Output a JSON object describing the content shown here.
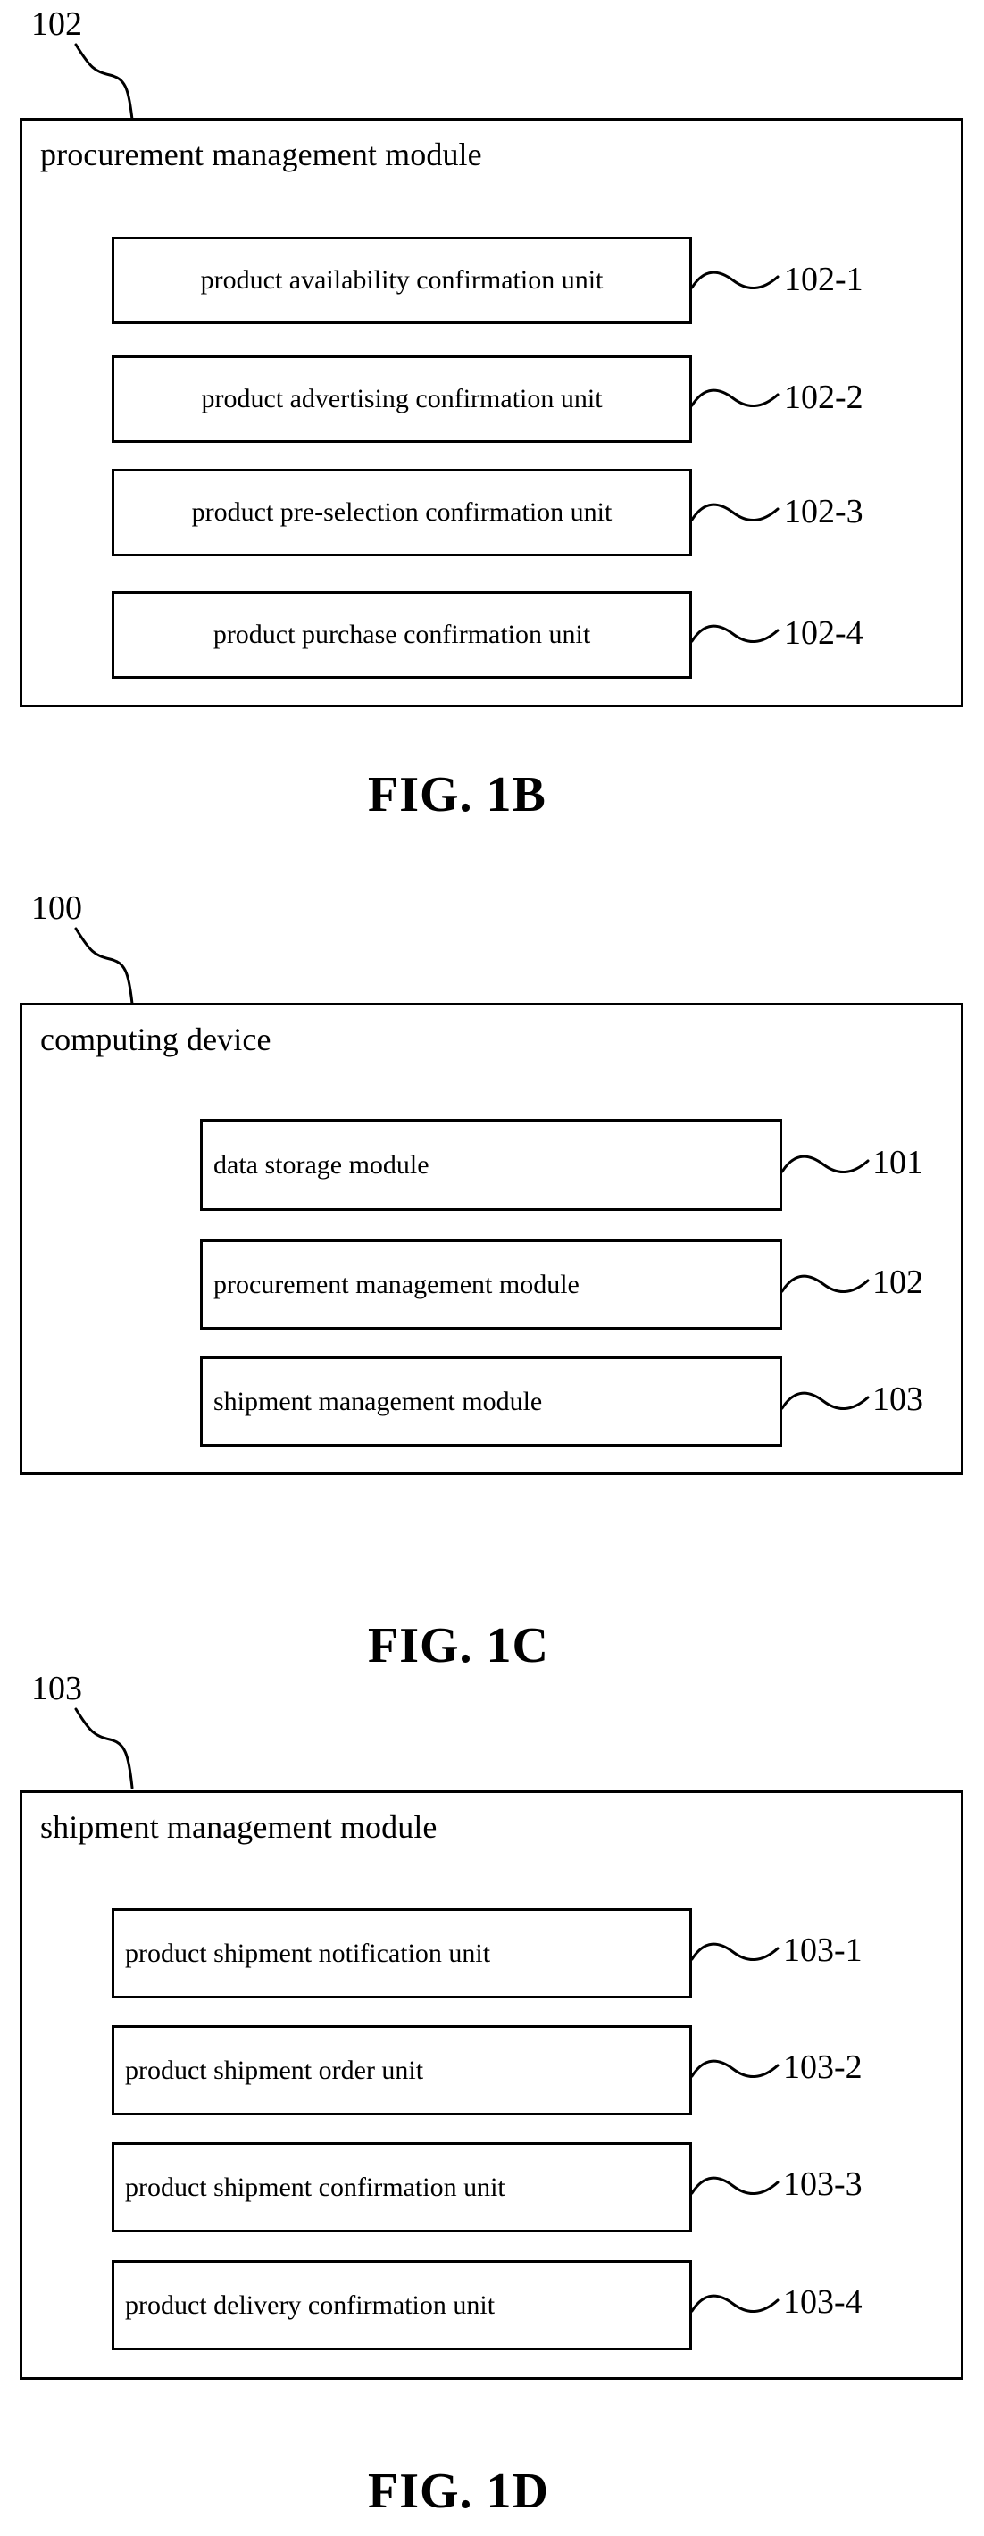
{
  "figures": [
    {
      "caption": "FIG. 1B",
      "callout": "102",
      "module_title": "procurement management module",
      "units": [
        {
          "label": "product availability confirmation unit",
          "ref": "102-1"
        },
        {
          "label": "product advertising confirmation unit",
          "ref": "102-2"
        },
        {
          "label": "product pre-selection confirmation unit",
          "ref": "102-3"
        },
        {
          "label": "product purchase confirmation unit",
          "ref": "102-4"
        }
      ]
    },
    {
      "caption": "FIG. 1C",
      "callout": "100",
      "module_title": "computing device",
      "units": [
        {
          "label": "data storage module",
          "ref": "101"
        },
        {
          "label": "procurement management module",
          "ref": "102"
        },
        {
          "label": "shipment management module",
          "ref": "103"
        }
      ]
    },
    {
      "caption": "FIG. 1D",
      "callout": "103",
      "module_title": "shipment management module",
      "units": [
        {
          "label": "product shipment notification unit",
          "ref": "103-1"
        },
        {
          "label": "product shipment order unit",
          "ref": "103-2"
        },
        {
          "label": "product shipment confirmation unit",
          "ref": "103-3"
        },
        {
          "label": "product delivery confirmation unit",
          "ref": "103-4"
        }
      ]
    }
  ],
  "colors": {
    "ink": "#000000",
    "paper": "#ffffff"
  }
}
